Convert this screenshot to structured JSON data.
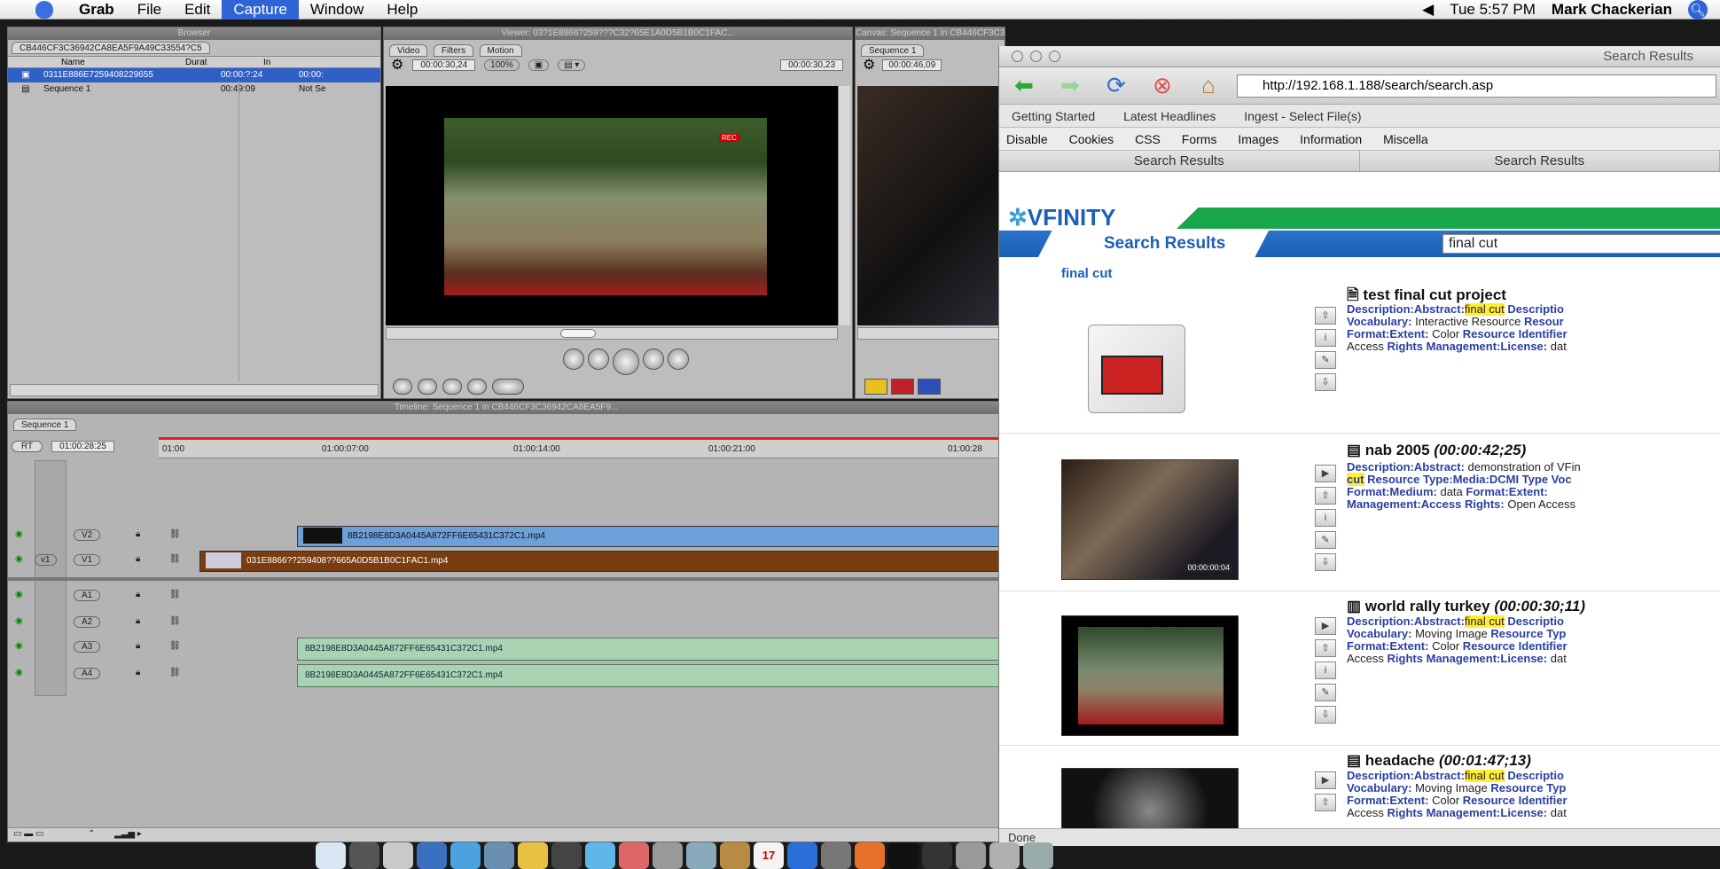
{
  "menubar": {
    "app": "Grab",
    "items": [
      "File",
      "Edit",
      "Capture",
      "Window",
      "Help"
    ],
    "active": "Capture",
    "clock": "Tue 5:57 PM",
    "user": "Mark Chackerian"
  },
  "fcp": {
    "browser": {
      "title": "Browser",
      "project_tab": "CB446CF3C36942CA8EA5F9A49C33554?C5",
      "col_name": "Name",
      "col_duration": "Durat",
      "col_in": "In",
      "rows": [
        {
          "name": "0311E886E7259408229655",
          "duration": "00:00:?:24",
          "in": "00:00:"
        },
        {
          "name": "Sequence 1",
          "duration": "00:49:09",
          "in": "Not Se"
        }
      ]
    },
    "viewer": {
      "title": "Viewer: 03?1E8866?259???C32?65E1A0D5B1B0C1FAC...",
      "tabs": [
        "Video",
        "Filters",
        "Motion"
      ],
      "timecode_left": "00:00:30,24",
      "zoom": "100%",
      "timecode_right": "00:00:30,23",
      "overlay_text": "REC"
    },
    "canvas": {
      "title": "Canvas: Sequence 1 in CB446CF3C36942CA8EA5F9...",
      "tab": "Sequence 1",
      "timecode": "00:00:46,09"
    },
    "timeline": {
      "title": "Timeline: Sequence 1 in CB446CF3C36942CA8EA5F9...",
      "tab": "Sequence 1",
      "rt": "RT",
      "timecode": "01:00:28:25",
      "ruler": [
        "01:00",
        "01:00:07:00",
        "01:00:14:00",
        "01:00:21:00",
        "01:00:28"
      ],
      "video_tracks": [
        {
          "label": "V2",
          "clip": "8B2198E8D3A0445A872FF6E65431C372C1.mp4"
        },
        {
          "label": "V1",
          "clip": "031E8866??259408??665A0D5B1B0C1FAC1.mp4"
        }
      ],
      "audio_tracks": [
        {
          "label": "A1",
          "clip": ""
        },
        {
          "label": "A2",
          "clip": ""
        },
        {
          "label": "A3",
          "clip": "8B2198E8D3A0445A872FF6E65431C372C1.mp4"
        },
        {
          "label": "A4",
          "clip": "8B2198E8D3A0445A872FF6E65431C372C1.mp4"
        }
      ]
    }
  },
  "safari": {
    "title": "Search Results",
    "url": "http://192.168.1.188/search/search.asp",
    "bookmarks": [
      "Getting Started",
      "Latest Headlines",
      "Ingest - Select File(s)"
    ],
    "devbar": [
      "Disable",
      "Cookies",
      "CSS",
      "Forms",
      "Images",
      "Information",
      "Miscella"
    ],
    "tabs": [
      "Search Results",
      "Search Results"
    ],
    "status": "Done",
    "brand": "VFINITY",
    "page_heading": "Search Results",
    "search_value": "final cut",
    "query_label": "final cut",
    "results": [
      {
        "title": "test final cut project",
        "duration": "",
        "lines": [
          [
            "Description:Abstract:",
            "final cut",
            "Descriptio"
          ],
          [
            "Vocabulary:",
            "Interactive Resource",
            "Resour"
          ],
          [
            "Format:Extent:",
            "Color",
            "Resource Identifier"
          ],
          [
            "Access",
            "Rights Management:License:",
            "dat"
          ]
        ]
      },
      {
        "title": "nab 2005",
        "duration": "(00:00:42;25)",
        "lines": [
          [
            "Description:Abstract:",
            "demonstration of VFin",
            ""
          ],
          [
            "cut",
            "Resource Type:Media:DCMI Type Voc",
            ""
          ],
          [
            "Format:Medium:",
            "data",
            "Format:Extent:"
          ],
          [
            "Management:Access Rights:",
            "Open Access",
            ""
          ]
        ]
      },
      {
        "title": "world rally turkey",
        "duration": "(00:00:30;11)",
        "lines": [
          [
            "Description:Abstract:",
            "final cut",
            "Descriptio"
          ],
          [
            "Vocabulary:",
            "Moving Image",
            "Resource Typ"
          ],
          [
            "Format:Extent:",
            "Color",
            "Resource Identifier"
          ],
          [
            "Access",
            "Rights Management:License:",
            "dat"
          ]
        ]
      },
      {
        "title": "headache",
        "duration": "(00:01:47;13)",
        "lines": [
          [
            "Description:Abstract:",
            "final cut",
            "Descriptio"
          ],
          [
            "Vocabulary:",
            "Moving Image",
            "Resource Typ"
          ],
          [
            "Format:Extent:",
            "Color",
            "Resource Identifier"
          ],
          [
            "Access",
            "Rights Management:License:",
            "dat"
          ]
        ]
      }
    ],
    "thumb_timecode": "00:00:00:04"
  },
  "dock": {
    "calendar_day": "17"
  },
  "colors": {
    "menu_highlight": "#2f64d6",
    "vfinity_green": "#1aa64a",
    "vfinity_blue": "#1c5fb8",
    "keyword_blue": "#2a3fa0",
    "highlight_yellow": "#ffee33",
    "v1_clip": "#7a3d12",
    "v2_clip": "#6d9fd8",
    "audio_clip": "#a9d3b3"
  }
}
